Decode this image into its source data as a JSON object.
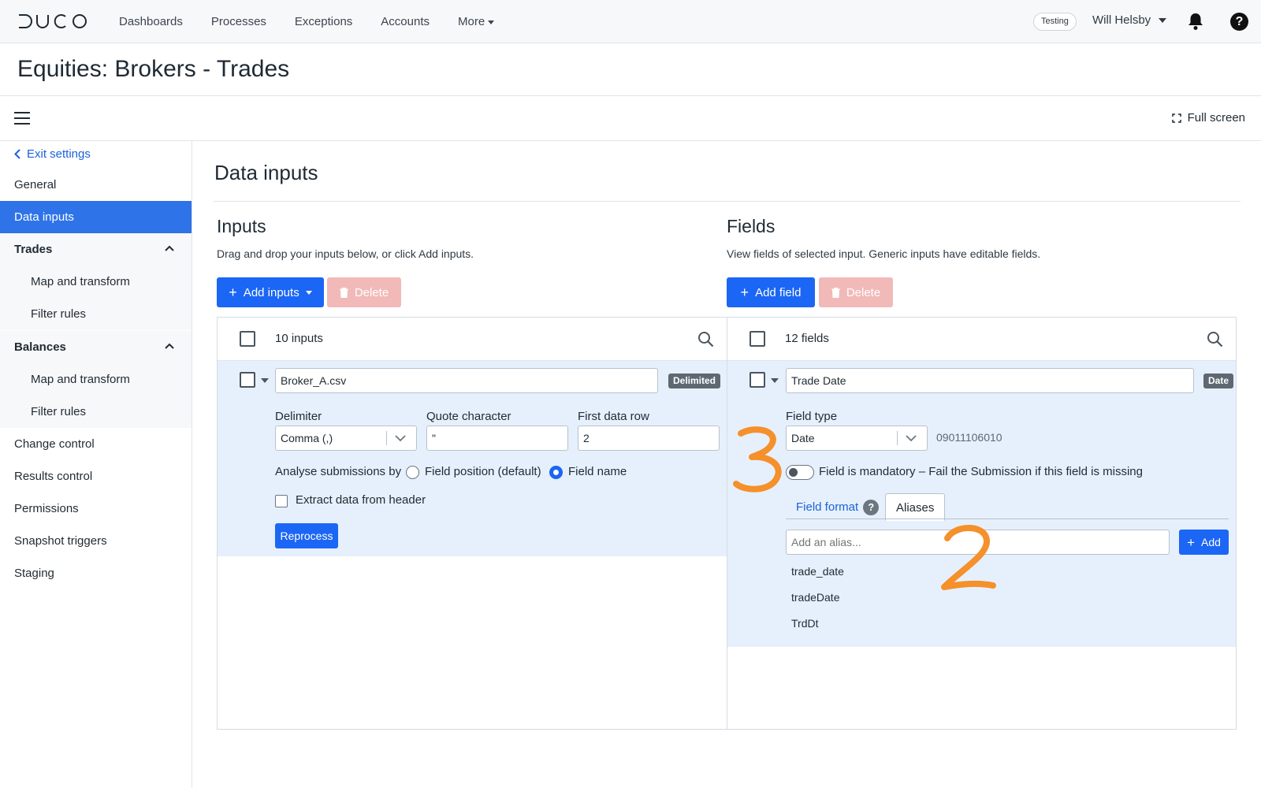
{
  "nav": {
    "links": [
      "Dashboards",
      "Processes",
      "Exceptions",
      "Accounts",
      "More"
    ],
    "env_badge": "Testing",
    "user_name": "Will Helsby"
  },
  "page": {
    "title": "Equities: Brokers - Trades",
    "fullscreen_label": "Full screen"
  },
  "sidebar": {
    "exit_label": "Exit settings",
    "items": {
      "general": "General",
      "data_inputs": "Data inputs",
      "trades": "Trades",
      "trades_map": "Map and transform",
      "trades_filter": "Filter rules",
      "balances": "Balances",
      "balances_map": "Map and transform",
      "balances_filter": "Filter rules",
      "change_control": "Change control",
      "results_control": "Results control",
      "permissions": "Permissions",
      "snapshot_triggers": "Snapshot triggers",
      "staging": "Staging"
    }
  },
  "main": {
    "title": "Data inputs",
    "inputs": {
      "title": "Inputs",
      "description": "Drag and drop your inputs below, or click Add inputs.",
      "add_label": "Add inputs",
      "delete_label": "Delete",
      "count_label": "10 inputs",
      "row": {
        "name": "Broker_A.csv",
        "tag": "Delimited",
        "delimiter_label": "Delimiter",
        "delimiter_value": "Comma (,)",
        "quote_label": "Quote character",
        "quote_value": "\"",
        "first_row_label": "First data row",
        "first_row_value": "2",
        "analyse_label": "Analyse submissions by",
        "option_position": "Field position (default)",
        "option_name": "Field name",
        "selected_option": "Field name",
        "extract_label": "Extract data from header",
        "reprocess_label": "Reprocess"
      }
    },
    "fields": {
      "title": "Fields",
      "description": "View fields of selected input. Generic inputs have editable fields.",
      "add_label": "Add field",
      "delete_label": "Delete",
      "count_label": "12 fields",
      "row": {
        "name": "Trade Date",
        "tag": "Date",
        "type_label": "Field type",
        "type_value": "Date",
        "type_code": "09011106010",
        "mandatory_label": "Field is mandatory – Fail the Submission if this field is missing",
        "tab_format": "Field format",
        "tab_aliases": "Aliases",
        "alias_placeholder": "Add an alias...",
        "alias_add_label": "Add",
        "aliases": [
          "trade_date",
          "tradeDate",
          "TrdDt"
        ]
      }
    }
  },
  "annotations": {
    "numbers": [
      "3",
      "2"
    ],
    "color": "#f5902a"
  },
  "colors": {
    "primary": "#1b66f5",
    "active_sidebar": "#2e73e8",
    "link": "#1a62d9",
    "expanded_row": "#e6f0fc",
    "disabled_delete": "#f2b9b9"
  }
}
